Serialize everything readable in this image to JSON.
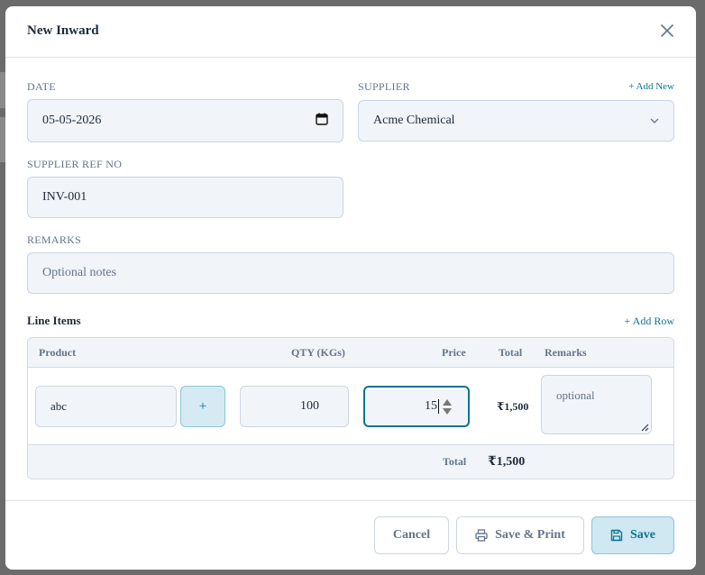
{
  "modal": {
    "title": "New Inward",
    "close_icon": "close-icon"
  },
  "form": {
    "date": {
      "label": "DATE",
      "value": "05-05-2026"
    },
    "supplier": {
      "label": "SUPPLIER",
      "value": "Acme Chemical",
      "add_new": "+ Add New"
    },
    "supplier_ref": {
      "label": "SUPPLIER REF NO",
      "value": "INV-001"
    },
    "remarks": {
      "label": "REMARKS",
      "placeholder": "Optional notes"
    }
  },
  "line_items": {
    "title": "Line Items",
    "add_row": "+ Add Row",
    "columns": [
      "Product",
      "QTY (KGs)",
      "Price",
      "Total",
      "Remarks"
    ],
    "rows": [
      {
        "product": "abc",
        "add_product": "+",
        "qty": "100",
        "price": "15",
        "total": "₹1,500",
        "remarks_placeholder": "optional"
      }
    ],
    "footer": {
      "label": "Total",
      "value": "₹1,500"
    }
  },
  "footer": {
    "cancel": "Cancel",
    "save_print": "Save & Print",
    "save": "Save"
  },
  "colors": {
    "accent": "#0e7490",
    "input_bg": "#f1f5f9",
    "border": "#cbd5e1"
  }
}
